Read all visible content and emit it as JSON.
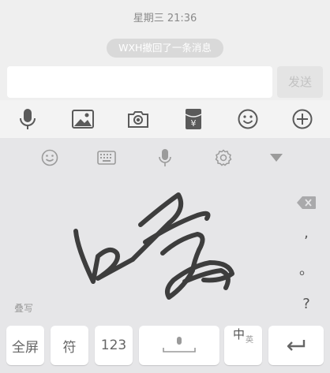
{
  "chat": {
    "timestamp": "星期三 21:36",
    "recall_notice": "WXH撤回了一条消息",
    "input_value": "",
    "send_label": "发送"
  },
  "toolbar": {
    "icons": [
      "microphone-icon",
      "image-icon",
      "camera-icon",
      "red-packet-icon",
      "emoji-icon",
      "plus-icon"
    ]
  },
  "keyboard": {
    "top_icons": [
      "emoji-icon",
      "keyboard-icon",
      "microphone-icon",
      "settings-icon",
      "collapse-icon"
    ],
    "mode_label": "叠写",
    "side_keys": [
      ",",
      "。",
      "?"
    ],
    "keys": {
      "fullscreen": "全屏",
      "symbol": "符",
      "numbers": "123",
      "lang_main": "中",
      "lang_sub": "英"
    }
  },
  "colors": {
    "icon": "#5a5a5a",
    "stroke": "#3d3d3d",
    "bubble": "#d9d9d9"
  }
}
